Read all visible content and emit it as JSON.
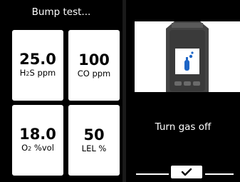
{
  "header": {
    "title": "Bump test..."
  },
  "readings": [
    {
      "value": "25.0",
      "unit_html": "H<sub>2</sub>S ppm"
    },
    {
      "value": "100",
      "unit": "CO ppm"
    },
    {
      "value": "18.0",
      "unit_html": "O<sub>2</sub> %vol"
    },
    {
      "value": "50",
      "unit": "LEL %"
    }
  ],
  "instruction": {
    "message": "Turn gas off"
  },
  "icons": {
    "device": "gas-detector-icon",
    "cylinder": "gas-cylinder-icon",
    "confirm": "checkmark-icon"
  }
}
